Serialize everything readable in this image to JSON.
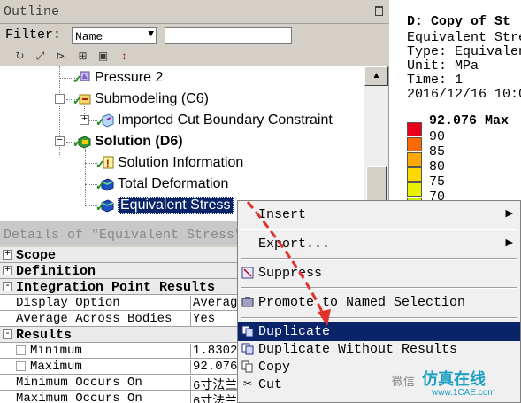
{
  "outline": {
    "title": "Outline",
    "filter_label": "Filter:",
    "filter_value": "Name",
    "filter_text": "",
    "toolbar_icons": [
      "refresh-icon",
      "expand-icon",
      "tree-icon",
      "plus-icon",
      "folder-icon",
      "sort-icon"
    ],
    "tree": [
      {
        "label": "Pressure 2",
        "icon": "pressure-icon",
        "bold": false
      },
      {
        "label": "Submodeling (C6)",
        "icon": "submodeling-icon",
        "bold": false
      },
      {
        "label": "Imported Cut Boundary Constraint",
        "icon": "imported-load-icon",
        "bold": false
      },
      {
        "label": "Solution (D6)",
        "icon": "solution-icon",
        "bold": true
      },
      {
        "label": "Solution Information",
        "icon": "info-icon",
        "bold": false
      },
      {
        "label": "Total Deformation",
        "icon": "result-icon",
        "bold": false
      },
      {
        "label": "Equivalent Stress",
        "icon": "result-icon",
        "bold": false
      }
    ]
  },
  "legend": {
    "lines": [
      "D: Copy of St",
      "Equivalent Stre",
      "Type: Equivalen",
      "Unit: MPa",
      "Time: 1",
      "2016/12/16 10:0"
    ],
    "max_label": "92.076 Max",
    "ticks": [
      "90",
      "85",
      "80",
      "75",
      "70"
    ],
    "colors": [
      "#e8001c",
      "#ff6a00",
      "#ffa800",
      "#ffd800",
      "#e9f000",
      "#c8f000"
    ]
  },
  "details": {
    "title": "Details of \"Equivalent Stress\"",
    "rows": [
      {
        "type": "group",
        "box": "+",
        "key": "Scope",
        "value": ""
      },
      {
        "type": "group",
        "box": "+",
        "key": "Definition",
        "value": ""
      },
      {
        "type": "group",
        "box": "-",
        "key": "Integration Point Results",
        "value": ""
      },
      {
        "type": "row",
        "key": "Display Option",
        "value": "Averag"
      },
      {
        "type": "row",
        "key": "Average Across Bodies",
        "value": "Yes"
      },
      {
        "type": "group",
        "box": "-",
        "key": "Results",
        "value": ""
      },
      {
        "type": "check",
        "key": "Minimum",
        "value": "1.8302"
      },
      {
        "type": "check",
        "key": "Maximum",
        "value": "92.076"
      },
      {
        "type": "row",
        "key": "Minimum Occurs On",
        "value": "6寸法兰"
      },
      {
        "type": "row",
        "key": "Maximum Occurs On",
        "value": "6寸法兰"
      }
    ]
  },
  "menu": {
    "items": [
      {
        "label": "Insert",
        "icon": "",
        "submenu": true,
        "highlight": false
      },
      {
        "label": "Export...",
        "icon": "",
        "submenu": true,
        "highlight": false
      },
      {
        "label": "Suppress",
        "icon": "suppress-icon",
        "submenu": false,
        "highlight": false
      },
      {
        "label": "Promote to Named Selection",
        "icon": "named-selection-icon",
        "submenu": false,
        "highlight": false
      },
      {
        "label": "Duplicate",
        "icon": "duplicate-icon",
        "submenu": false,
        "highlight": true
      },
      {
        "label": "Duplicate Without Results",
        "icon": "duplicate-icon",
        "submenu": false,
        "highlight": false
      },
      {
        "label": "Copy",
        "icon": "copy-icon",
        "submenu": false,
        "highlight": false
      },
      {
        "label": "Cut",
        "icon": "cut-icon",
        "submenu": false,
        "highlight": false
      }
    ]
  },
  "watermark": {
    "text": "仿真在线",
    "sub": "www.1CAE.com",
    "left": "微信"
  },
  "accent": {
    "selection": "#0a246a",
    "arrow": "#e0332d",
    "check": "#1a8a1a"
  }
}
